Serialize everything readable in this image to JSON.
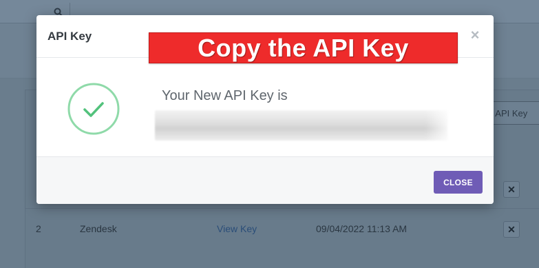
{
  "background": {
    "search_icon": "search-icon",
    "new_key_button_label": "w API Key",
    "row": {
      "number": "2",
      "name": "Zendesk",
      "view_key": "View Key",
      "date": "09/04/2022 11:13 AM"
    },
    "remove_icon": "close-icon"
  },
  "modal": {
    "title": "API Key",
    "close_icon": "close-icon",
    "banner_text": "Copy the API Key",
    "success_icon": "checkmark-circle-icon",
    "key_label": "Your New API Key is",
    "close_button_label": "CLOSE"
  },
  "colors": {
    "banner": "#ee2b2b",
    "success": "#5ccb84",
    "primary_button": "#6f5cb6",
    "overlay": "#6a7d8d"
  }
}
